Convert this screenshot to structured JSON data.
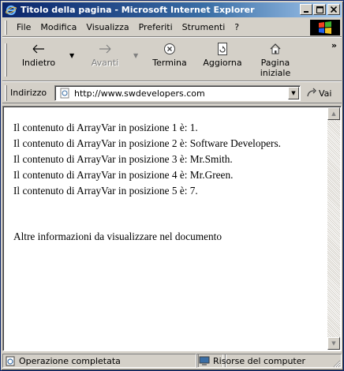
{
  "window": {
    "title": "Titolo della pagina - Microsoft Internet Explorer",
    "caption_buttons": {
      "minimize": "_",
      "maximize": "□",
      "close": "X"
    }
  },
  "menu": {
    "items": [
      "File",
      "Modifica",
      "Visualizza",
      "Preferiti",
      "Strumenti",
      "?"
    ]
  },
  "toolbar": {
    "back_label": "Indietro",
    "forward_label": "Avanti",
    "stop_label": "Termina",
    "refresh_label": "Aggiorna",
    "home_label": "Pagina iniziale",
    "more": "»"
  },
  "address": {
    "label": "Indirizzo",
    "url": "http://www.swdevelopers.com",
    "go_label": "Vai"
  },
  "document": {
    "lines": [
      "Il contenuto di ArrayVar in posizione 1 è: 1.",
      "Il contenuto di ArrayVar in posizione 2 è: Software Developers.",
      "Il contenuto di ArrayVar in posizione 3 è: Mr.Smith.",
      "Il contenuto di ArrayVar in posizione 4 è: Mr.Green.",
      "Il contenuto di ArrayVar in posizione 5 è: 7."
    ],
    "footer_text": "Altre informazioni da visualizzare nel documento"
  },
  "status": {
    "message": "Operazione completata",
    "zone": "Risorse del computer"
  },
  "colors": {
    "titlebar_start": "#0a246a",
    "titlebar_end": "#a6caf0",
    "chrome": "#d4d0c8"
  }
}
